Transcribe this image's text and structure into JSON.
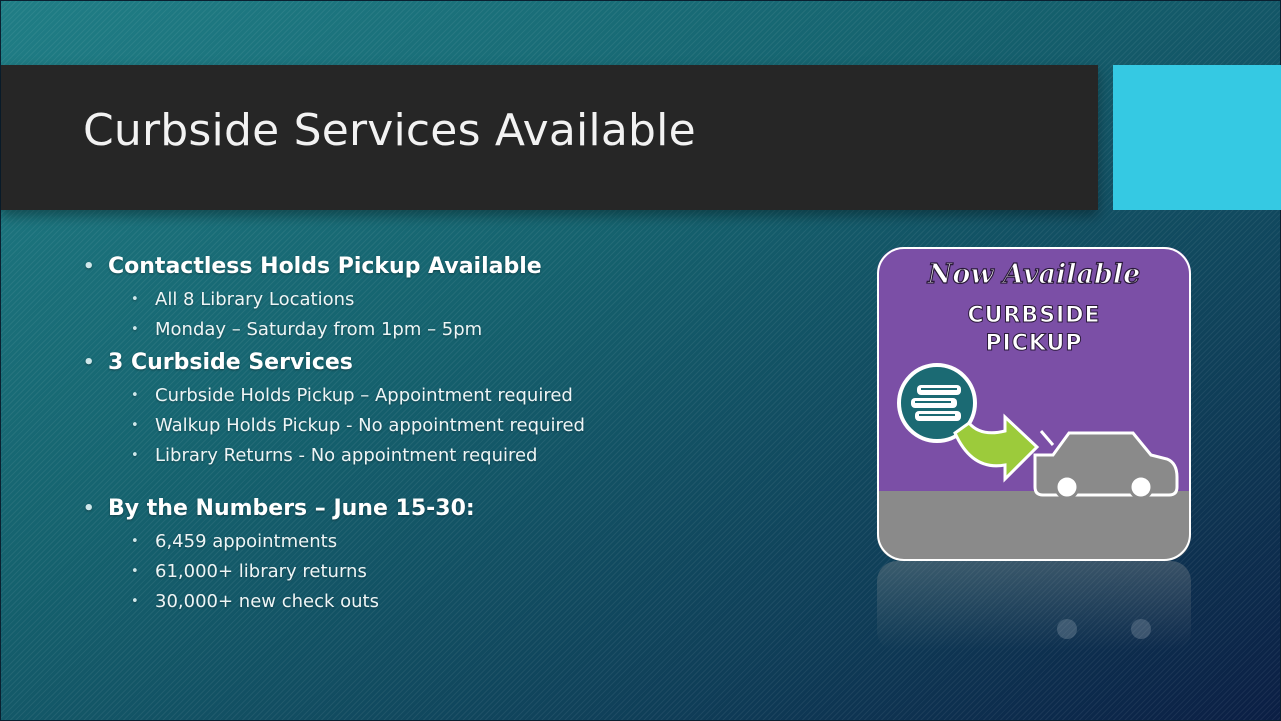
{
  "slide": {
    "title": "Curbside Services Available",
    "bullets": [
      {
        "text": "Contactless Holds Pickup Available",
        "sub": [
          "All 8 Library Locations",
          "Monday – Saturday from 1pm – 5pm"
        ]
      },
      {
        "text": "3 Curbside Services",
        "sub": [
          "Curbside Holds Pickup – Appointment required",
          "Walkup Holds Pickup - No appointment required",
          "Library Returns - No appointment required"
        ]
      },
      {
        "text": "By the Numbers – June 15-30:",
        "sub": [
          "6,459 appointments",
          "61,000+ library returns",
          "30,000+ new check outs"
        ]
      }
    ],
    "bullet_glyph": "•"
  },
  "graphic": {
    "headline": "Now Available",
    "line1": "CURBSIDE",
    "line2": "PICKUP",
    "icons": [
      "books-icon",
      "arrow-icon",
      "car-icon"
    ]
  },
  "colors": {
    "title_bar": "#262626",
    "accent": "#35c9e3",
    "graphic_purple": "#7b4fa6",
    "graphic_gray": "#8a8a8a",
    "arrow_green": "#9ccb3b",
    "books_circle": "#1b6a73"
  }
}
